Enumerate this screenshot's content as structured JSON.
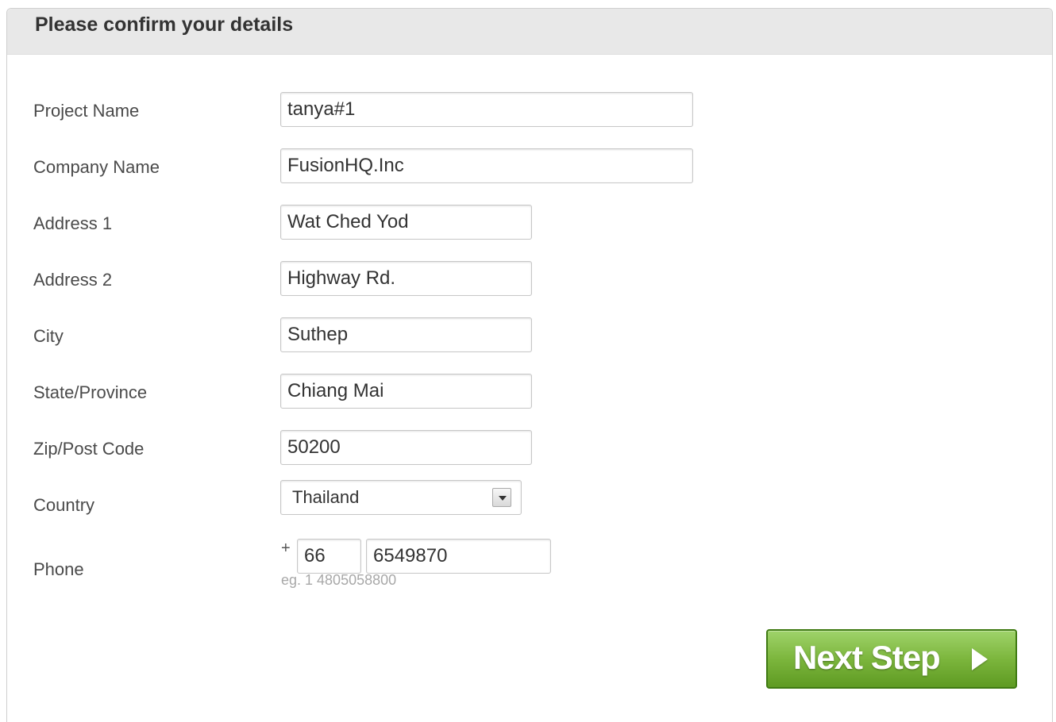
{
  "panel": {
    "title": "Please confirm your details"
  },
  "form": {
    "project_name": {
      "label": "Project Name",
      "value": "tanya#1"
    },
    "company_name": {
      "label": "Company Name",
      "value": "FusionHQ.Inc"
    },
    "address1": {
      "label": "Address 1",
      "value": "Wat Ched Yod"
    },
    "address2": {
      "label": "Address 2",
      "value": "Highway Rd."
    },
    "city": {
      "label": "City",
      "value": "Suthep"
    },
    "state": {
      "label": "State/Province",
      "value": "Chiang Mai"
    },
    "zip": {
      "label": "Zip/Post Code",
      "value": "50200"
    },
    "country": {
      "label": "Country",
      "value": "Thailand"
    },
    "phone": {
      "label": "Phone",
      "prefix": "+",
      "country_code": "66",
      "number": "6549870",
      "hint": "eg. 1 4805058800"
    }
  },
  "actions": {
    "next_label": "Next Step",
    "next_icon": "play-arrow-icon"
  },
  "colors": {
    "button_green": "#7cb63d",
    "header_bg": "#e8e8e8"
  }
}
